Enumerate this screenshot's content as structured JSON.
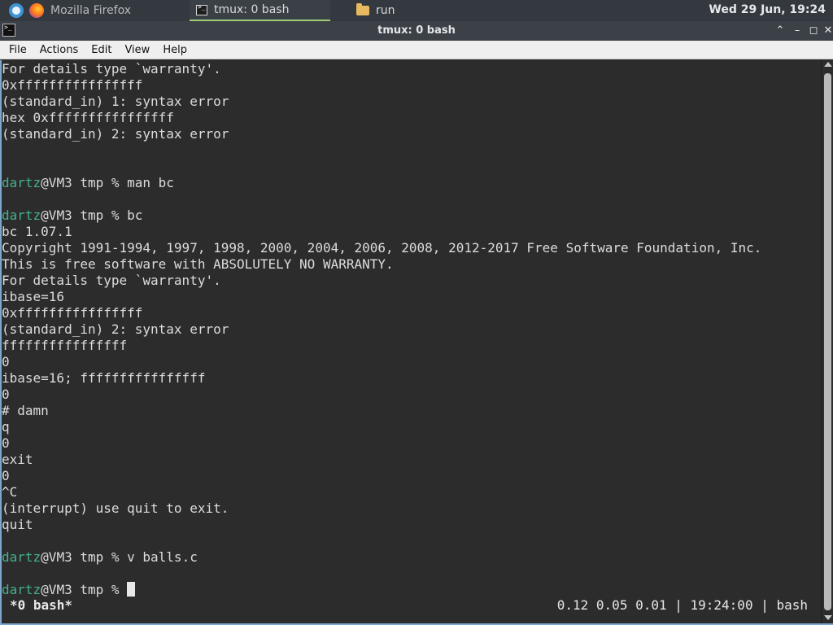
{
  "panel": {
    "taskbar": [
      {
        "label": "Mozilla Firefox",
        "icon": "firefox-icon",
        "active": false
      },
      {
        "label": "tmux: 0 bash",
        "icon": "terminal-icon",
        "active": true
      },
      {
        "label": "run",
        "icon": "folder-icon",
        "active": false
      }
    ],
    "clock": "Wed 29 Jun, 19:24"
  },
  "window": {
    "title": "tmux: 0 bash",
    "controls": {
      "maximize": "⌃",
      "minimize": "–",
      "restore": "◻",
      "close": "✕"
    }
  },
  "menubar": [
    "File",
    "Actions",
    "Edit",
    "View",
    "Help"
  ],
  "terminal": {
    "lines": [
      "For details type `warranty'.",
      "0xffffffffffffffff",
      "(standard_in) 1: syntax error",
      "hex 0xffffffffffffffff",
      "(standard_in) 2: syntax error",
      "",
      "",
      {
        "user": "dartz",
        "rest": "@VM3 tmp % man bc"
      },
      "",
      {
        "user": "dartz",
        "rest": "@VM3 tmp % bc"
      },
      "bc 1.07.1",
      "Copyright 1991-1994, 1997, 1998, 2000, 2004, 2006, 2008, 2012-2017 Free Software Foundation, Inc.",
      "This is free software with ABSOLUTELY NO WARRANTY.",
      "For details type `warranty'.",
      "ibase=16",
      "0xffffffffffffffff",
      "(standard_in) 2: syntax error",
      "ffffffffffffffff",
      "0",
      "ibase=16; ffffffffffffffff",
      "0",
      "# damn",
      "q",
      "0",
      "exit",
      "0",
      "^C",
      "(interrupt) use quit to exit.",
      "quit",
      "",
      {
        "user": "dartz",
        "rest": "@VM3 tmp % v balls.c"
      },
      "",
      {
        "user": "dartz",
        "rest": "@VM3 tmp % ",
        "cursor": true
      }
    ],
    "status_left": "*0 bash*",
    "status_right": "0.12 0.05 0.01 | 19:24:00 | bash"
  },
  "colors": {
    "prompt_user": "#43b08e",
    "terminal_bg": "#2c2c2c",
    "terminal_fg": "#dcdcdc",
    "active_task_underline": "#9fcb75"
  }
}
